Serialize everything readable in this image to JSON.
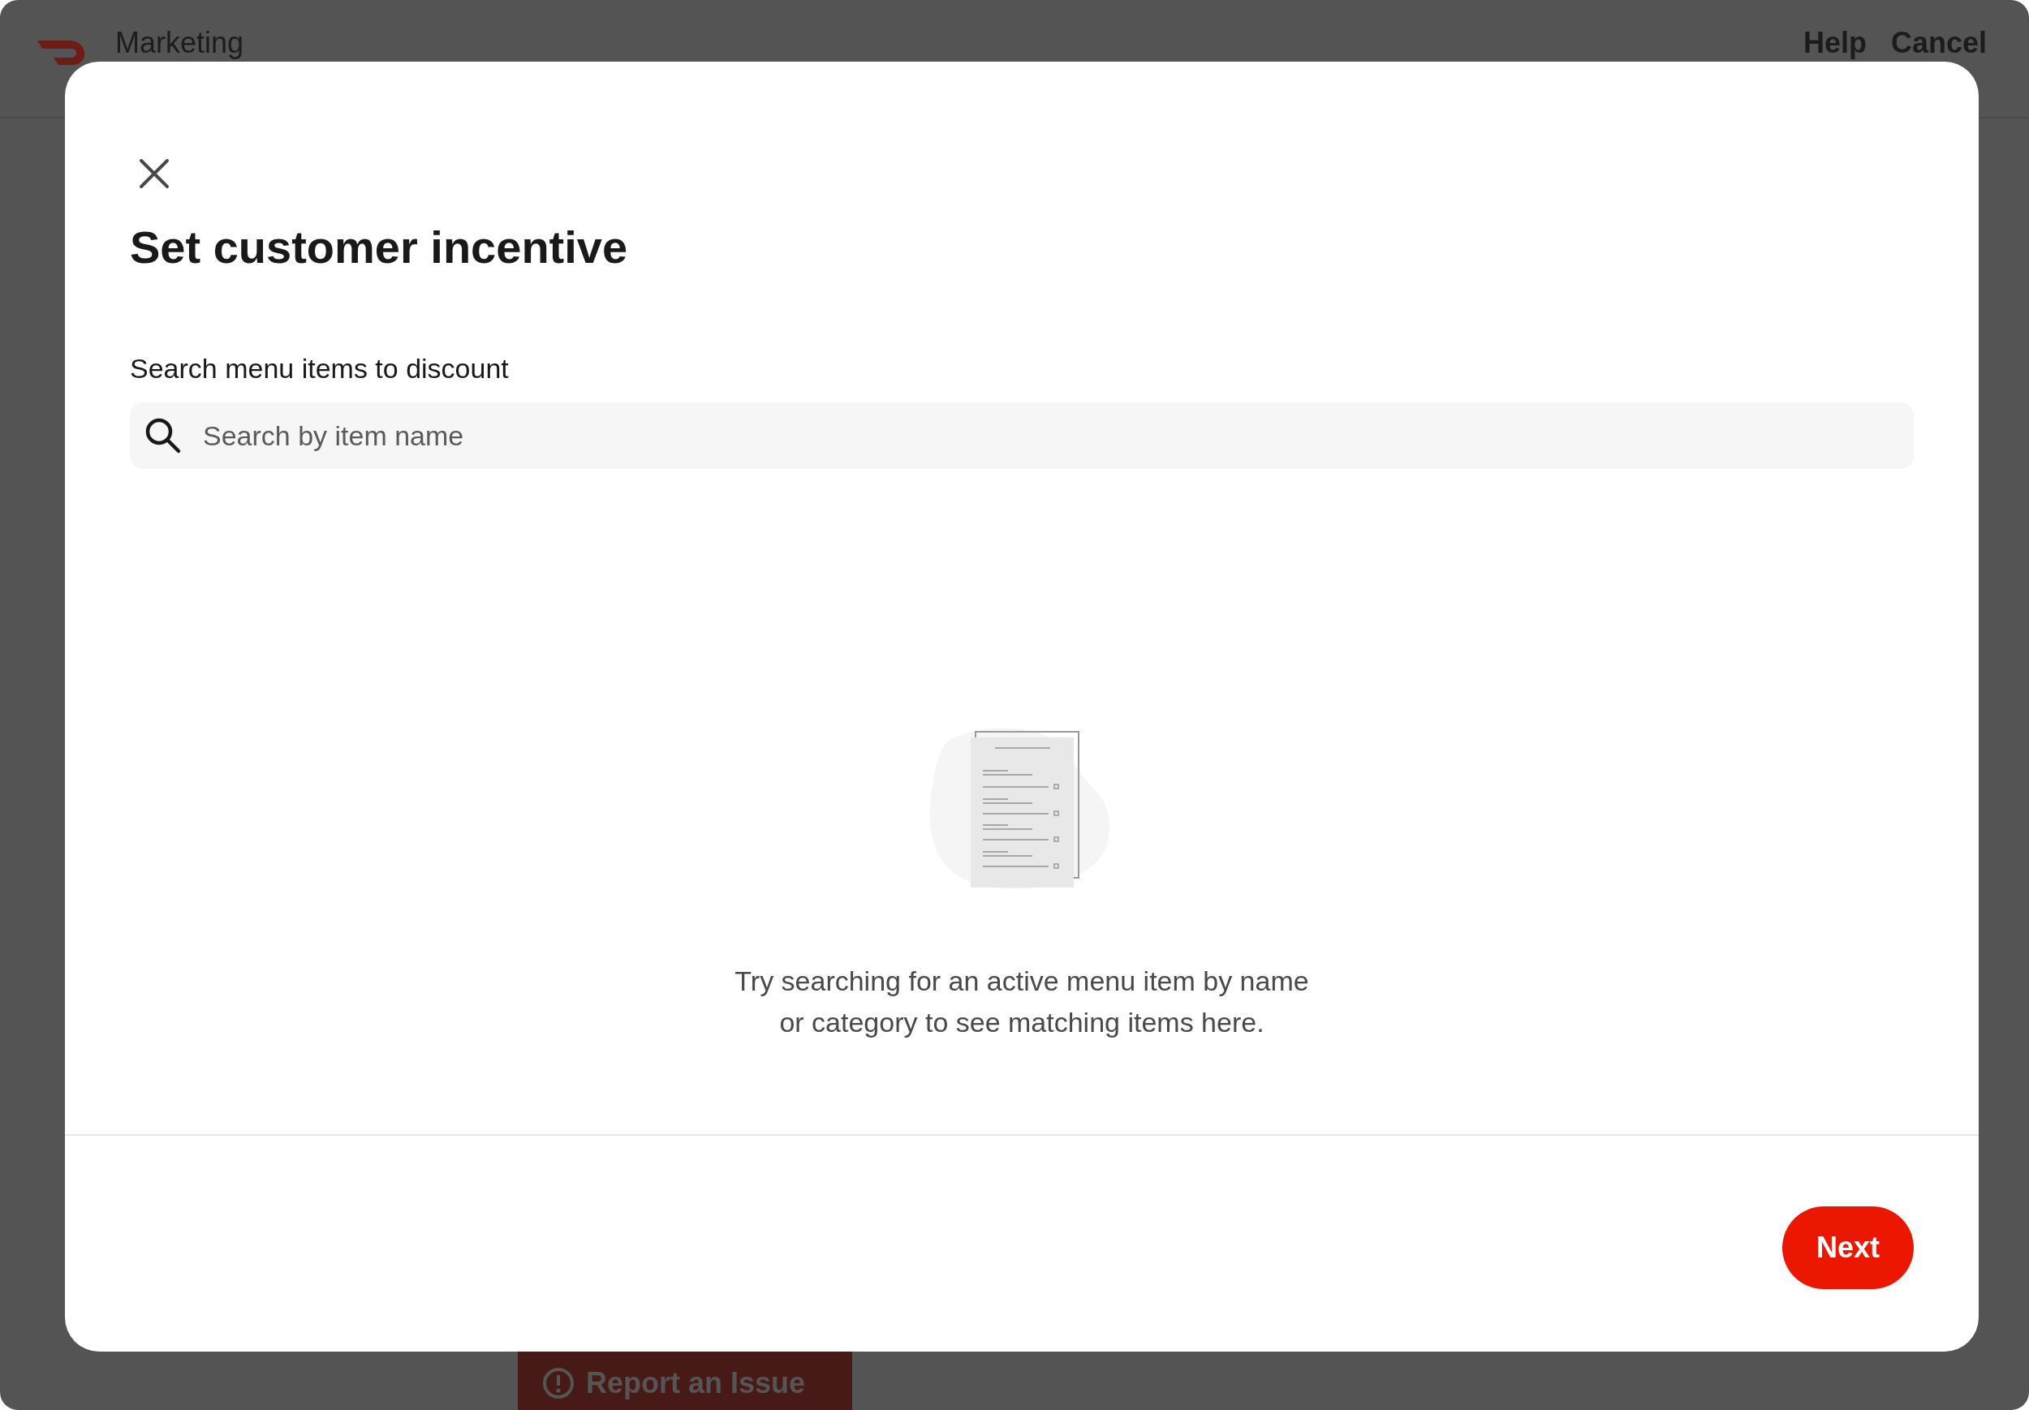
{
  "background": {
    "app_name": "Marketing",
    "header_links": [
      "Help",
      "Cancel"
    ],
    "report_button": "Report an Issue"
  },
  "modal": {
    "title": "Set customer incentive",
    "search_label": "Search menu items to discount",
    "search": {
      "placeholder": "Search by item name"
    },
    "empty_message": "Try searching for an active menu item by name or category to see matching items here.",
    "buttons": [
      "Next"
    ]
  }
}
